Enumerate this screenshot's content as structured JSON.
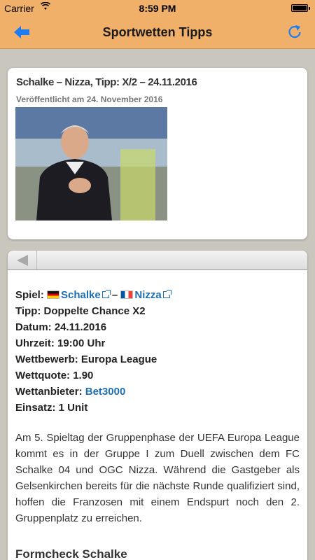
{
  "status": {
    "carrier": "Carrier",
    "time": "8:59 PM",
    "battery_level": 1.0
  },
  "nav": {
    "title": "Sportwetten Tipps",
    "back_icon": "back-arrow-icon",
    "refresh_icon": "refresh-icon"
  },
  "colors": {
    "nav_background": "#f0b06a",
    "page_background": "#c9c6be",
    "link": "#1f6fb2",
    "icon_blue": "#1e7cf2"
  },
  "card": {
    "headline": "Schalke – Nizza, Tipp: X/2 – 24.11.2016",
    "date": "Veröffentlicht am 24. November 2016"
  },
  "article": {
    "toolbar_back_icon": "triangle-left-icon",
    "facts": {
      "spiel_label": "Spiel:",
      "team_home": "Schalke",
      "separator": "–",
      "team_away": "Nizza",
      "tipp": "Tipp: Doppelte Chance X2",
      "datum": "Datum: 24.11.2016",
      "uhrzeit": "Uhrzeit: 19:00 Uhr",
      "wettbewerb": "Wettbewerb: Europa League",
      "wettquote": "Wettquote: 1.90",
      "wettanbieter_label": "Wettanbieter:",
      "wettanbieter": "Bet3000",
      "einsatz": "Einsatz: 1 Unit"
    },
    "paragraph": "Am 5. Spieltag der Gruppenphase der UEFA Europa League kommt es in der Gruppe I zum Duell zwischen dem FC Schalke 04 und OGC Nizza. Während die Gastgeber als Gelsenkirchen bereits für die nächste Runde qualifiziert sind, hoffen die Franzosen mit einem Endspurt noch den 2. Gruppenplatz zu erreichen.",
    "subheading": "Formcheck Schalke"
  }
}
